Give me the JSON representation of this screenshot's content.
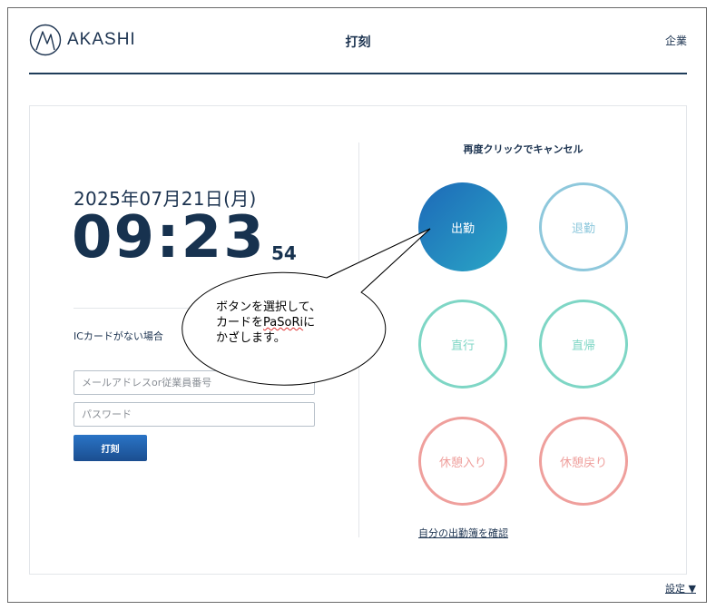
{
  "header": {
    "logo_text": "AKASHI",
    "title": "打刻",
    "company_link": "企業"
  },
  "clock": {
    "date": "2025年07月21日(月)",
    "time": "09:23",
    "seconds": "54"
  },
  "login": {
    "ic_label": "ICカードがない場合",
    "email_placeholder": "メールアドレスor従業員番号",
    "password_placeholder": "パスワード",
    "punch_label": "打刻"
  },
  "stamps": {
    "cancel_hint": "再度クリックでキャンセル",
    "clock_in": "出勤",
    "clock_out": "退勤",
    "direct_in": "直行",
    "direct_out": "直帰",
    "break_in": "休憩入り",
    "break_out": "休憩戻り",
    "attendance_link": "自分の出勤簿を確認"
  },
  "footer": {
    "settings": "設定 ▼"
  },
  "callout": {
    "line1": "ボタンを選択して、",
    "line2_prefix": "カードを",
    "line2_word": "PaSoRi",
    "line2_suffix": "に",
    "line3": "かざします。"
  },
  "colors": {
    "navy": "#1c3350",
    "clock_in_gradient_start": "#1d69b8",
    "clock_in_gradient_end": "#2aa6c6",
    "clock_out": "#8ec8dc",
    "direct": "#7ed6c5",
    "break": "#ef9f9c"
  },
  "icons": {
    "logo": "akashi-logo-icon"
  }
}
